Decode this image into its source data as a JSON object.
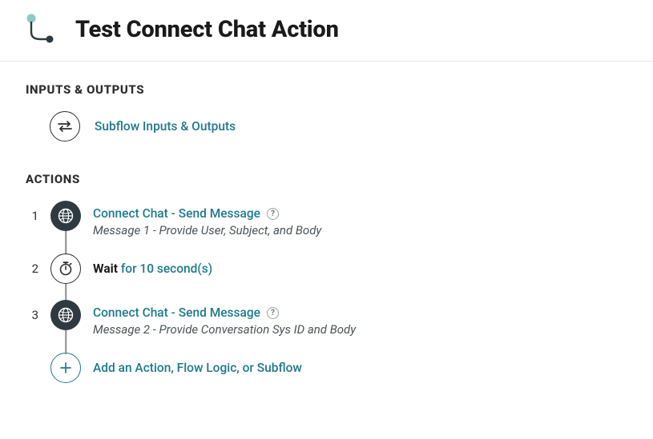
{
  "header": {
    "title": "Test Connect Chat Action"
  },
  "sections": {
    "io_heading": "INPUTS & OUTPUTS",
    "actions_heading": "ACTIONS"
  },
  "io": {
    "link_label": "Subflow Inputs & Outputs"
  },
  "actions": [
    {
      "index": "1",
      "kind": "action",
      "title": "Connect Chat - Send Message",
      "description": "Message 1 - Provide User, Subject, and Body"
    },
    {
      "index": "2",
      "kind": "wait",
      "wait_strong": "Wait",
      "wait_rest": " for 10 second(s)"
    },
    {
      "index": "3",
      "kind": "action",
      "title": "Connect Chat - Send Message",
      "description": "Message 2 - Provide Conversation Sys ID and Body"
    }
  ],
  "add": {
    "label": "Add an Action, Flow Logic, or Subflow"
  },
  "help_glyph": "?"
}
